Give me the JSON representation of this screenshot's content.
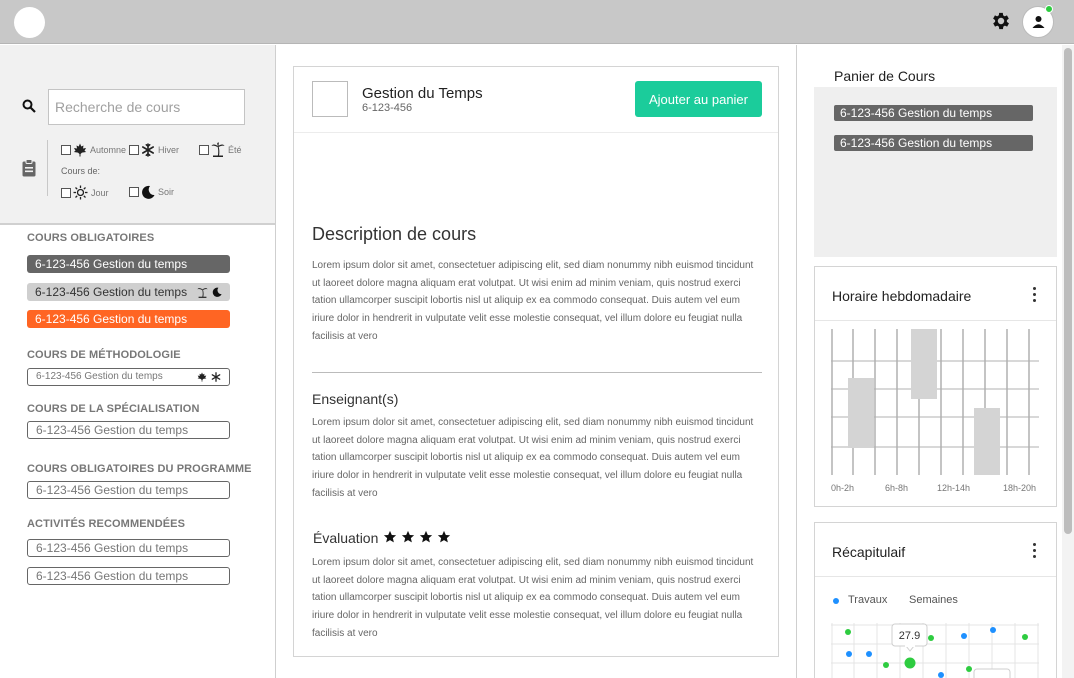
{
  "header": {
    "settings_icon": "gear-icon",
    "user_icon": "user-icon"
  },
  "search": {
    "placeholder": "Recherche de cours"
  },
  "filters": {
    "seasons": [
      {
        "label": "Automne",
        "icon": "maple-leaf-icon"
      },
      {
        "label": "Hiver",
        "icon": "snowflake-icon"
      },
      {
        "label": "Été",
        "icon": "palm-tree-icon"
      }
    ],
    "cours_de_label": "Cours de:",
    "times": [
      {
        "label": "Jour",
        "icon": "sun-icon"
      },
      {
        "label": "Soir",
        "icon": "moon-icon"
      }
    ]
  },
  "sidebar": {
    "sections": [
      {
        "title": "COURS OBLIGATOIRES",
        "items": [
          {
            "label": "6-123-456 Gestion du temps",
            "style": "dark"
          },
          {
            "label": "6-123-456 Gestion du temps",
            "style": "gray",
            "icons": [
              "palm-tree-icon",
              "moon-icon"
            ]
          },
          {
            "label": "6-123-456 Gestion du temps",
            "style": "orange"
          }
        ]
      },
      {
        "title": "COURS DE MÉTHODOLOGIE",
        "items": [
          {
            "label": "6-123-456 Gestion du temps",
            "style": "outline",
            "icons": [
              "maple-leaf-icon",
              "snowflake-icon"
            ]
          }
        ]
      },
      {
        "title": "COURS DE LA SPÉCIALISATION",
        "items": [
          {
            "label": "6-123-456 Gestion du temps",
            "style": "outline"
          }
        ]
      },
      {
        "title": "COURS OBLIGATOIRES DU PROGRAMME",
        "items": [
          {
            "label": "6-123-456 Gestion du temps",
            "style": "outline"
          }
        ]
      },
      {
        "title": "ACTIVITÉS RECOMMENDÉES",
        "items": [
          {
            "label": "6-123-456 Gestion du temps",
            "style": "outline"
          },
          {
            "label": "6-123-456 Gestion du temps",
            "style": "outline"
          }
        ]
      }
    ]
  },
  "course": {
    "name": "Gestion du Temps",
    "code": "6-123-456",
    "add_button": "Ajouter au panier",
    "description_title": "Description de cours",
    "description": "Lorem ipsum dolor sit amet, consectetuer adipiscing elit, sed diam nonummy nibh euismod tincidunt ut laoreet dolore magna aliquam erat volutpat. Ut wisi enim ad minim veniam, quis nostrud exerci tation ullamcorper suscipit lobortis nisl ut aliquip ex ea commodo consequat. Duis autem vel eum iriure dolor in hendrerit in vulputate velit esse molestie consequat, vel illum dolore eu feugiat nulla facilisis at vero",
    "teachers_title": "Enseignant(s)",
    "teachers_text": "Lorem ipsum dolor sit amet, consectetuer adipiscing elit, sed diam nonummy nibh euismod tincidunt ut laoreet dolore magna aliquam erat volutpat. Ut wisi enim ad minim veniam, quis nostrud exerci tation ullamcorper suscipit lobortis nisl ut aliquip ex ea commodo consequat. Duis autem vel eum iriure dolor in hendrerit in vulputate velit esse molestie consequat, vel illum dolore eu feugiat nulla facilisis at vero",
    "evaluation_title": "Évaluation",
    "rating": 4,
    "evaluation_text": "Lorem ipsum dolor sit amet, consectetuer adipiscing elit, sed diam nonummy nibh euismod tincidunt ut laoreet dolore magna aliquam erat volutpat. Ut wisi enim ad minim veniam, quis nostrud exerci tation ullamcorper suscipit lobortis nisl ut aliquip ex ea commodo consequat. Duis autem vel eum iriure dolor in hendrerit in vulputate velit esse molestie consequat, vel illum dolore eu feugiat nulla facilisis at vero"
  },
  "cart": {
    "title": "Panier de Cours",
    "items": [
      "6-123-456 Gestion du temps",
      "6-123-456 Gestion du temps"
    ]
  },
  "schedule": {
    "title": "Horaire hebdomadaire",
    "x_labels": [
      "0h-2h",
      "6h-8h",
      "12h-14h",
      "18h-20h"
    ]
  },
  "summary": {
    "title": "Récapitulaif",
    "legend": [
      "Travaux",
      "Semaines"
    ],
    "tooltip": "27.9"
  },
  "colors": {
    "accent": "#1bcc9b",
    "orange": "#ff6523",
    "blue_dot": "#1e90ff",
    "green_dot": "#2ecc40"
  }
}
